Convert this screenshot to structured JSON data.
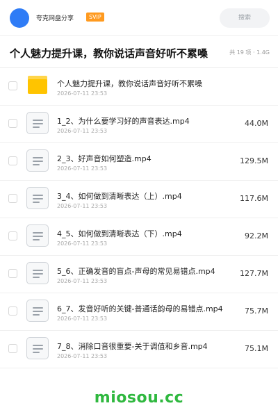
{
  "header": {
    "app_name": "夸克网盘分享",
    "badge": "SVIP",
    "search_placeholder": "搜索"
  },
  "folder": {
    "title": "个人魅力提升课，教你说话声音好听不累嗓",
    "meta": "共 19 项 · 1.4G"
  },
  "files": [
    {
      "type": "folder",
      "name": "个人魅力提升课，教你说话声音好听不累嗓",
      "date": "2026-07-11 23:53",
      "size": ""
    },
    {
      "type": "file",
      "name": "1_2、为什么要学习好的声音表达.mp4",
      "date": "2026-07-11 23:53",
      "size": "44.0M"
    },
    {
      "type": "file",
      "name": "2_3、好声音如何塑造.mp4",
      "date": "2026-07-11 23:53",
      "size": "129.5M"
    },
    {
      "type": "file",
      "name": "3_4、如何做到清晰表达（上）.mp4",
      "date": "2026-07-11 23:53",
      "size": "117.6M"
    },
    {
      "type": "file",
      "name": "4_5、如何做到清晰表达（下）.mp4",
      "date": "2026-07-11 23:53",
      "size": "92.2M"
    },
    {
      "type": "file",
      "name": "5_6、正确发音的盲点-声母的常见易错点.mp4",
      "date": "2026-07-11 23:53",
      "size": "127.7M"
    },
    {
      "type": "file",
      "name": "6_7、发音好听的关键-普通话韵母的易错点.mp4",
      "date": "2026-07-11 23:53",
      "size": "75.7M"
    },
    {
      "type": "file",
      "name": "7_8、消除口音很重要-关于调值和乡音.mp4",
      "date": "2026-07-11 23:53",
      "size": "75.1M"
    }
  ],
  "watermark": "miosou.cc",
  "colors": {
    "accent": "#2f7cf6",
    "badge": "#ff9a1f",
    "folder": "#ffc400",
    "watermark": "#2fb83f"
  }
}
